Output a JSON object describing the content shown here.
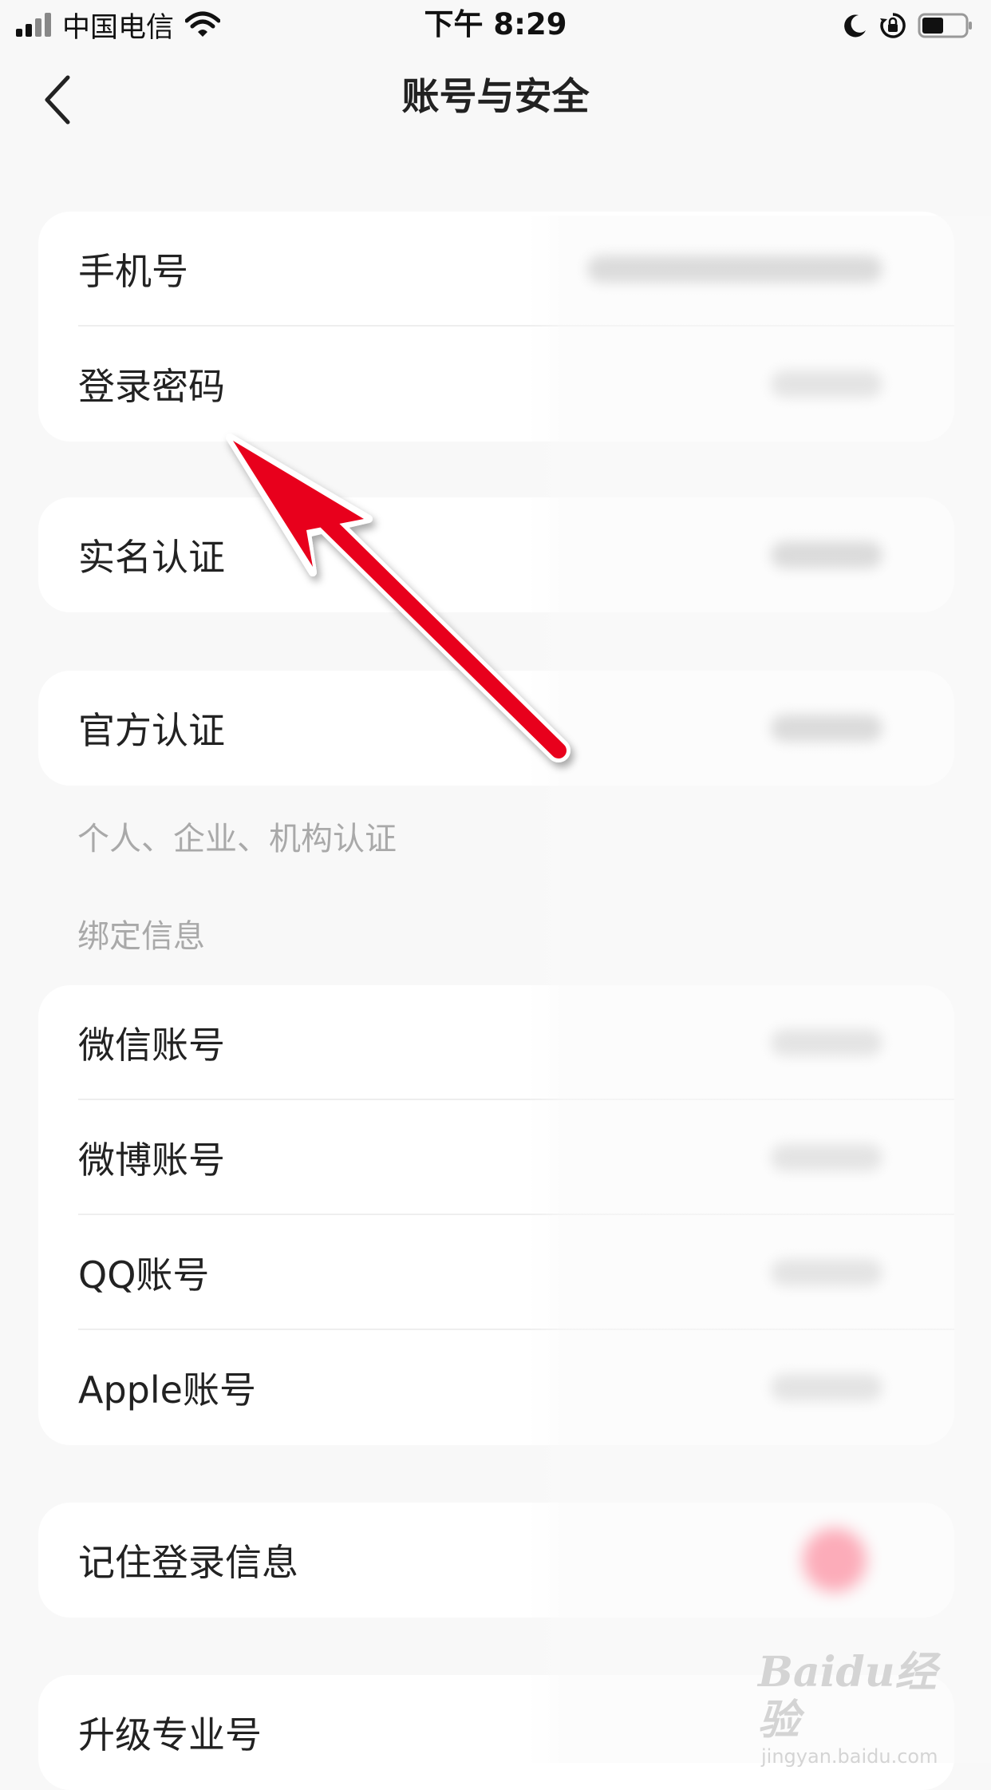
{
  "status_bar": {
    "carrier": "中国电信",
    "time": "下午 8:29"
  },
  "nav": {
    "title": "账号与安全"
  },
  "account_group": [
    {
      "label": "手机号"
    },
    {
      "label": "登录密码"
    }
  ],
  "realname": {
    "label": "实名认证"
  },
  "official": {
    "label": "官方认证"
  },
  "official_note": "个人、企业、机构认证",
  "binding_section_title": "绑定信息",
  "binding_group": [
    {
      "label": "微信账号"
    },
    {
      "label": "微博账号"
    },
    {
      "label": "QQ账号"
    },
    {
      "label": "Apple账号"
    }
  ],
  "remember_login": {
    "label": "记住登录信息"
  },
  "upgrade": {
    "label": "升级专业号"
  },
  "watermark": {
    "brand": "Baidu经验",
    "url": "jingyan.baidu.com"
  },
  "colors": {
    "background": "#f8f8f8",
    "card": "#ffffff",
    "arrow": "#e8001c",
    "toggle": "#ff4d6a"
  },
  "icons": [
    "signal-icon",
    "wifi-icon",
    "moon-icon",
    "rotation-lock-icon",
    "battery-icon",
    "back-chevron-icon"
  ]
}
